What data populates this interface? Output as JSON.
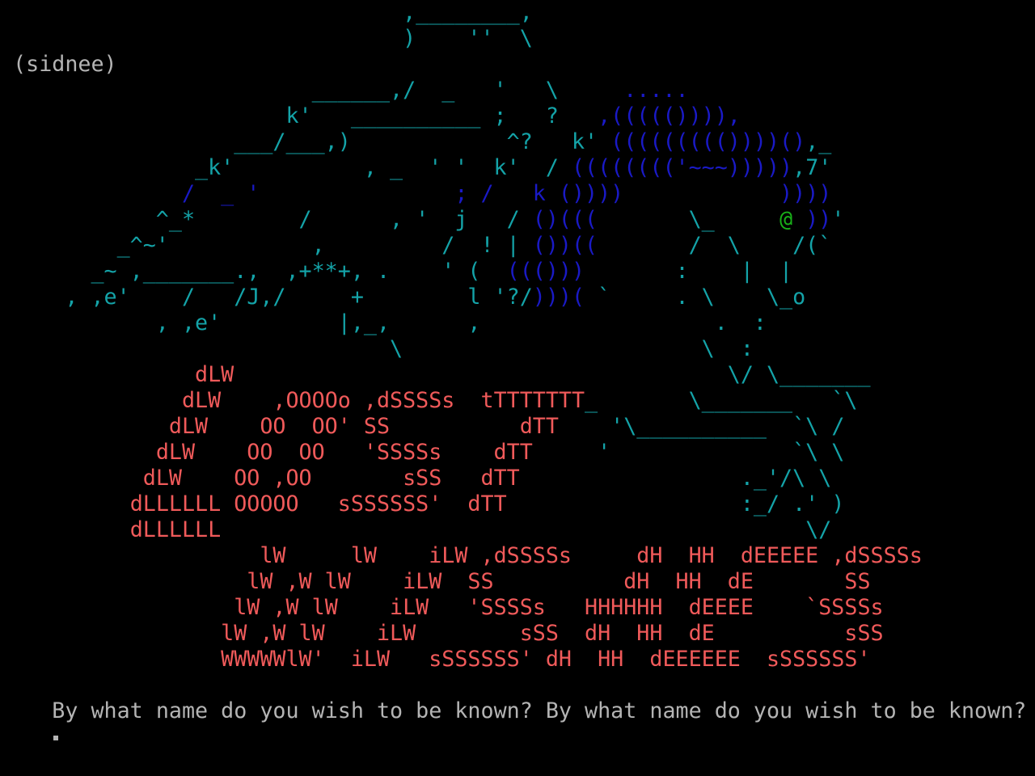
{
  "colors": {
    "background": "#000000",
    "art_cyan": "#14a3a8",
    "art_blue": "#1a1ac6",
    "art_green": "#18b018",
    "logo_red": "#f05a5a",
    "text_grey": "#b4b4b4"
  },
  "art": [
    {
      "segs": [
        {
          "t": "                               ,________,",
          "c": "art_cyan"
        }
      ]
    },
    {
      "segs": [
        {
          "t": "                               )    ''  \\",
          "c": "art_cyan"
        }
      ]
    },
    {
      "segs": [
        {
          "t": " ",
          "c": "art_cyan"
        },
        {
          "t": "(sidnee)",
          "c": "text_grey"
        },
        {
          "t": "                                 ",
          "c": "art_cyan"
        }
      ]
    },
    {
      "segs": [
        {
          "t": "                        ______,/  _   '   \\     ",
          "c": "art_cyan"
        },
        {
          "t": ".....",
          "c": "art_blue"
        }
      ]
    },
    {
      "segs": [
        {
          "t": "                      k'   __________ ;   ?   ",
          "c": "art_cyan"
        },
        {
          "t": ",((((()))),",
          "c": "art_blue"
        }
      ]
    },
    {
      "segs": [
        {
          "t": "                  ___/___,)            ^?   k' ",
          "c": "art_cyan"
        },
        {
          "t": "((((((((())))()",
          "c": "art_blue"
        },
        {
          "t": ",_",
          "c": "art_cyan"
        }
      ]
    },
    {
      "segs": [
        {
          "t": "               _k'          , _  ' '  k'  / ",
          "c": "art_cyan"
        },
        {
          "t": "(((((((('~~~)))))",
          "c": "art_blue"
        },
        {
          "t": ",7'",
          "c": "art_cyan"
        }
      ]
    },
    {
      "segs": [
        {
          "t": "              /  _ '               ; /   k ",
          "c": "art_blue"
        },
        {
          "t": "())))",
          "c": "art_blue"
        },
        {
          "t": "            ",
          "c": "art_cyan"
        },
        {
          "t": "))))",
          "c": "art_blue"
        }
      ]
    },
    {
      "segs": [
        {
          "t": "            ^_*        /      , '  j   / ",
          "c": "art_cyan"
        },
        {
          "t": "()(((",
          "c": "art_blue"
        },
        {
          "t": "       \\_     ",
          "c": "art_cyan"
        },
        {
          "t": "@",
          "c": "art_green"
        },
        {
          "t": " ",
          "c": "art_cyan"
        },
        {
          "t": "))",
          "c": "art_blue"
        },
        {
          "t": "'",
          "c": "art_cyan"
        }
      ]
    },
    {
      "segs": [
        {
          "t": "         _^~'           ,         /  ! | ",
          "c": "art_cyan"
        },
        {
          "t": "())((",
          "c": "art_blue"
        },
        {
          "t": "       /  \\    /(`",
          "c": "art_cyan"
        }
      ]
    },
    {
      "segs": [
        {
          "t": "       _~ ,_______.,  ,+**+, .    ' (  ",
          "c": "art_cyan"
        },
        {
          "t": "((()))",
          "c": "art_blue"
        },
        {
          "t": "       :    |  |",
          "c": "art_cyan"
        }
      ]
    },
    {
      "segs": [
        {
          "t": "     , ,e'    /   /J,/     +        l '?/",
          "c": "art_cyan"
        },
        {
          "t": ")))(",
          "c": "art_blue"
        },
        {
          "t": " `     . \\    \\_o",
          "c": "art_cyan"
        }
      ]
    },
    {
      "segs": [
        {
          "t": "            , ,e'         |,_,      ,                  .  :",
          "c": "art_cyan"
        }
      ]
    },
    {
      "segs": [
        {
          "t": "                              \\                       \\  :",
          "c": "art_cyan"
        }
      ]
    },
    {
      "segs": [
        {
          "t": "               ",
          "c": "art_cyan"
        },
        {
          "t": "dLW",
          "c": "logo_red"
        },
        {
          "t": "                                      \\/ \\_______",
          "c": "art_cyan"
        }
      ]
    },
    {
      "segs": [
        {
          "t": "              ",
          "c": "art_cyan"
        },
        {
          "t": "dLW    ,OOOOo ,dSSSSs  tTTTTTTT",
          "c": "logo_red"
        },
        {
          "t": "_       \\_______   `\\",
          "c": "art_cyan"
        }
      ]
    },
    {
      "segs": [
        {
          "t": "             ",
          "c": "art_cyan"
        },
        {
          "t": "dLW    OO  OO' SS          dTT",
          "c": "logo_red"
        },
        {
          "t": "    '\\__________  `\\ /",
          "c": "art_cyan"
        }
      ]
    },
    {
      "segs": [
        {
          "t": "            ",
          "c": "art_cyan"
        },
        {
          "t": "dLW    OO  OO   'SSSSs    dTT",
          "c": "logo_red"
        },
        {
          "t": "     '              `\\ \\",
          "c": "art_cyan"
        }
      ]
    },
    {
      "segs": [
        {
          "t": "           ",
          "c": "art_cyan"
        },
        {
          "t": "dLW    OO ,OO       sSS   dTT",
          "c": "logo_red"
        },
        {
          "t": "                 ._'/\\ \\",
          "c": "art_cyan"
        }
      ]
    },
    {
      "segs": [
        {
          "t": "          ",
          "c": "art_cyan"
        },
        {
          "t": "dLLLLLL OOOOO   sSSSSSS'  dTT",
          "c": "logo_red"
        },
        {
          "t": "                  :_/ .' )",
          "c": "art_cyan"
        }
      ]
    },
    {
      "segs": [
        {
          "t": "          ",
          "c": "art_cyan"
        },
        {
          "t": "dLLLLLL",
          "c": "logo_red"
        },
        {
          "t": "                                             \\/",
          "c": "art_cyan"
        }
      ]
    },
    {
      "segs": [
        {
          "t": "                    ",
          "c": "art_cyan"
        },
        {
          "t": "lW     lW    iLW ,dSSSSs     dH  HH  dEEEEE ,dSSSSs",
          "c": "logo_red"
        }
      ]
    },
    {
      "segs": [
        {
          "t": "                   ",
          "c": "art_cyan"
        },
        {
          "t": "lW ,W lW    iLW  SS          dH  HH  dE       SS",
          "c": "logo_red"
        }
      ]
    },
    {
      "segs": [
        {
          "t": "                  ",
          "c": "art_cyan"
        },
        {
          "t": "lW ,W lW    iLW   'SSSSs   HHHHHH  dEEEE    `SSSSs",
          "c": "logo_red"
        }
      ]
    },
    {
      "segs": [
        {
          "t": "                 ",
          "c": "art_cyan"
        },
        {
          "t": "lW ,W lW    iLW        sSS  dH  HH  dE          sSS",
          "c": "logo_red"
        }
      ]
    },
    {
      "segs": [
        {
          "t": "                 ",
          "c": "art_cyan"
        },
        {
          "t": "WWWWWlW'  iLW   sSSSSSS' dH  HH  dEEEEEE  sSSSSSS'",
          "c": "logo_red"
        }
      ]
    }
  ],
  "prompt": {
    "text": "By what name do you wish to be known? By what name do you wish to be known?",
    "cursor_color": "#b4b4b4"
  }
}
